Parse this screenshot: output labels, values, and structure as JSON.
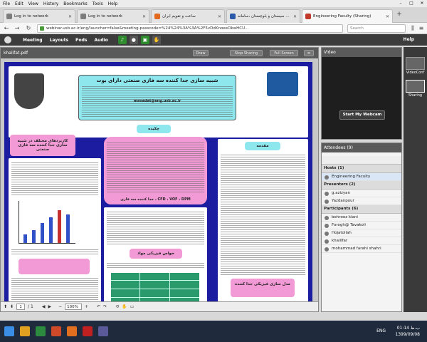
{
  "browser": {
    "menu": [
      "File",
      "Edit",
      "View",
      "History",
      "Bookmarks",
      "Tools",
      "Help"
    ],
    "tabs": [
      {
        "label": "Log in to network",
        "active": false
      },
      {
        "label": "Log in to network",
        "active": false
      },
      {
        "label": "ساعت و تقویم ایران",
        "active": false
      },
      {
        "label": "دانشگاه سیستان و بلوچستان ،سامانه",
        "active": false
      },
      {
        "label": "Engineering Faculty (Sharing)",
        "active": true
      }
    ],
    "url": "webinar.usb.ac.ir/eng/launcher=false&meeting-passcode=%24%24%3A%3A%2F5vDdKnoeeOkwHCU...",
    "search_placeholder": "Search"
  },
  "app": {
    "menus": [
      "Meeting",
      "Layouts",
      "Pods",
      "Audio"
    ],
    "help_label": "Help"
  },
  "share": {
    "title": "khalifat.pdf",
    "buttons": [
      "Draw",
      "Stop Sharing",
      "Full Screen"
    ],
    "poster": {
      "title": "شبیه سازی جدا کننده سه فازی صنعتی دارای بوت",
      "abstract_label": "چکیده",
      "intro_label": "مقدمه",
      "left_label": "کاربردهای مختلف در شبیه سازی جدا کننده سه فازی صنعتی",
      "results_label": "خواص فیزیکی مواد",
      "keywords": "CFD ، VOF ، DPM ، جدا کننده سه فازی",
      "right_label": "مدل سازی فیزیکی جدا کننده",
      "email": "mavadat@eng.usb.ac.ir"
    },
    "page_current": "1",
    "page_total": "/ 1",
    "zoom": "100%"
  },
  "video": {
    "title": "Video",
    "webcam_button": "Start My Webcam"
  },
  "attendees": {
    "title": "Attendees",
    "count": "(9)",
    "hosts_label": "Hosts (1)",
    "hosts": [
      "Engineering Faculty"
    ],
    "presenters_label": "Presenters (2)",
    "presenters": [
      "g.azizyan",
      "Yazdanpour"
    ],
    "participants_label": "Participants (6)",
    "participants": [
      "behrooz kiani",
      "Forogh@ Tavakoli",
      "Hojatollah",
      "khalilfar",
      "mohammad farahi shahri"
    ]
  },
  "sidebar": {
    "items": [
      "VideoConf",
      "Sharing"
    ]
  },
  "taskbar": {
    "lang": "ENG",
    "time": "01:14 ب.ظ",
    "date": "1399/09/08"
  }
}
